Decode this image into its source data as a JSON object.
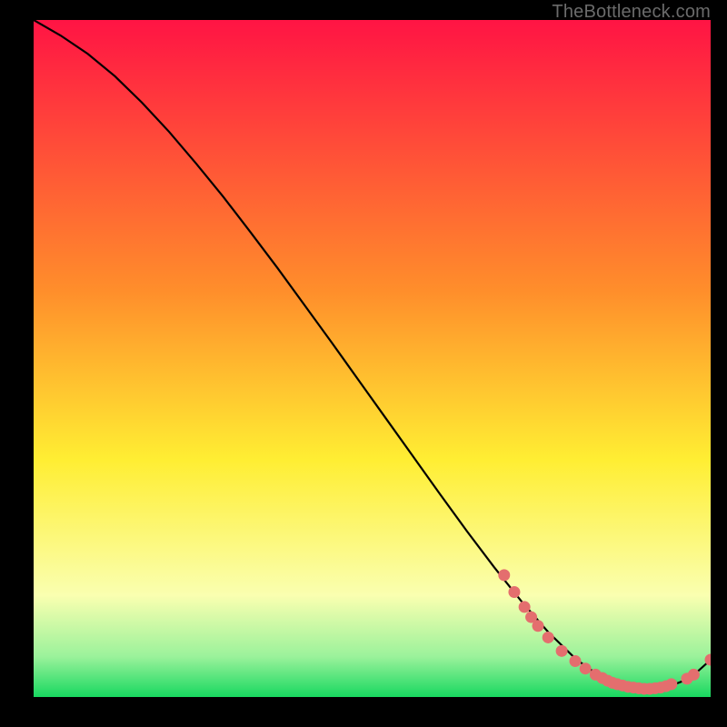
{
  "attribution": "TheBottleneck.com",
  "colors": {
    "marker": "#e46e6e",
    "curve": "#000000",
    "grad_top": "#ff1444",
    "grad_orange": "#ff8e2b",
    "grad_yellow": "#ffee33",
    "grad_pale": "#faffb0",
    "grad_green_light": "#9bf29b",
    "grad_green": "#18d860"
  },
  "chart_data": {
    "type": "line",
    "title": "",
    "xlabel": "",
    "ylabel": "",
    "xlim": [
      0,
      100
    ],
    "ylim": [
      0,
      100
    ],
    "series": [
      {
        "name": "bottleneck-curve",
        "x": [
          0,
          4,
          8,
          12,
          16,
          20,
          24,
          28,
          32,
          36,
          40,
          44,
          48,
          52,
          56,
          60,
          64,
          68,
          72,
          76,
          80,
          82,
          84,
          86,
          88,
          90,
          92,
          94,
          96,
          98,
          100
        ],
        "y": [
          100,
          97.7,
          95.0,
          91.7,
          87.8,
          83.5,
          78.8,
          73.9,
          68.7,
          63.4,
          57.9,
          52.4,
          46.8,
          41.2,
          35.6,
          30.0,
          24.5,
          19.2,
          14.2,
          9.6,
          5.7,
          4.2,
          3.0,
          2.1,
          1.5,
          1.2,
          1.2,
          1.6,
          2.4,
          3.7,
          5.5
        ]
      },
      {
        "name": "markers",
        "marker_only": true,
        "points": [
          {
            "x": 69.5,
            "y": 18.0
          },
          {
            "x": 71.0,
            "y": 15.5
          },
          {
            "x": 72.5,
            "y": 13.3
          },
          {
            "x": 73.5,
            "y": 11.8
          },
          {
            "x": 74.5,
            "y": 10.5
          },
          {
            "x": 76.0,
            "y": 8.8
          },
          {
            "x": 78.0,
            "y": 6.8
          },
          {
            "x": 80.0,
            "y": 5.3
          },
          {
            "x": 81.5,
            "y": 4.2
          },
          {
            "x": 83.0,
            "y": 3.3
          },
          {
            "x": 84.0,
            "y": 2.8
          },
          {
            "x": 84.8,
            "y": 2.4
          },
          {
            "x": 85.5,
            "y": 2.1
          },
          {
            "x": 86.2,
            "y": 1.9
          },
          {
            "x": 87.0,
            "y": 1.7
          },
          {
            "x": 87.8,
            "y": 1.5
          },
          {
            "x": 88.6,
            "y": 1.4
          },
          {
            "x": 89.4,
            "y": 1.3
          },
          {
            "x": 90.2,
            "y": 1.2
          },
          {
            "x": 91.0,
            "y": 1.2
          },
          {
            "x": 91.8,
            "y": 1.3
          },
          {
            "x": 92.6,
            "y": 1.4
          },
          {
            "x": 93.4,
            "y": 1.6
          },
          {
            "x": 94.2,
            "y": 1.9
          },
          {
            "x": 96.5,
            "y": 2.7
          },
          {
            "x": 97.5,
            "y": 3.3
          },
          {
            "x": 100.0,
            "y": 5.5
          }
        ]
      }
    ]
  }
}
